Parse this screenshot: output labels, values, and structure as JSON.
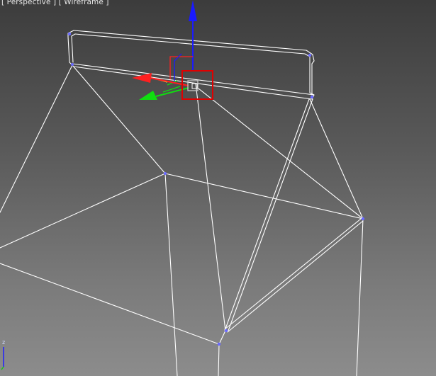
{
  "viewport": {
    "label_prefix": "[ ",
    "view_name": "Perspective",
    "separator": " ] [ ",
    "render_mode": "Wireframe",
    "label_suffix": " ]"
  },
  "axis_tripod": {
    "z_label": "z"
  },
  "colors": {
    "wire": "#ffffff",
    "vertex": "#6a6aff",
    "gizmo_x": "#ff2020",
    "gizmo_y": "#10dd10",
    "gizmo_z": "#1a1aff",
    "gizmo_plane": "#ffff30",
    "selection_box": "#e00000",
    "gizmo_center": "#c8c8c8"
  }
}
